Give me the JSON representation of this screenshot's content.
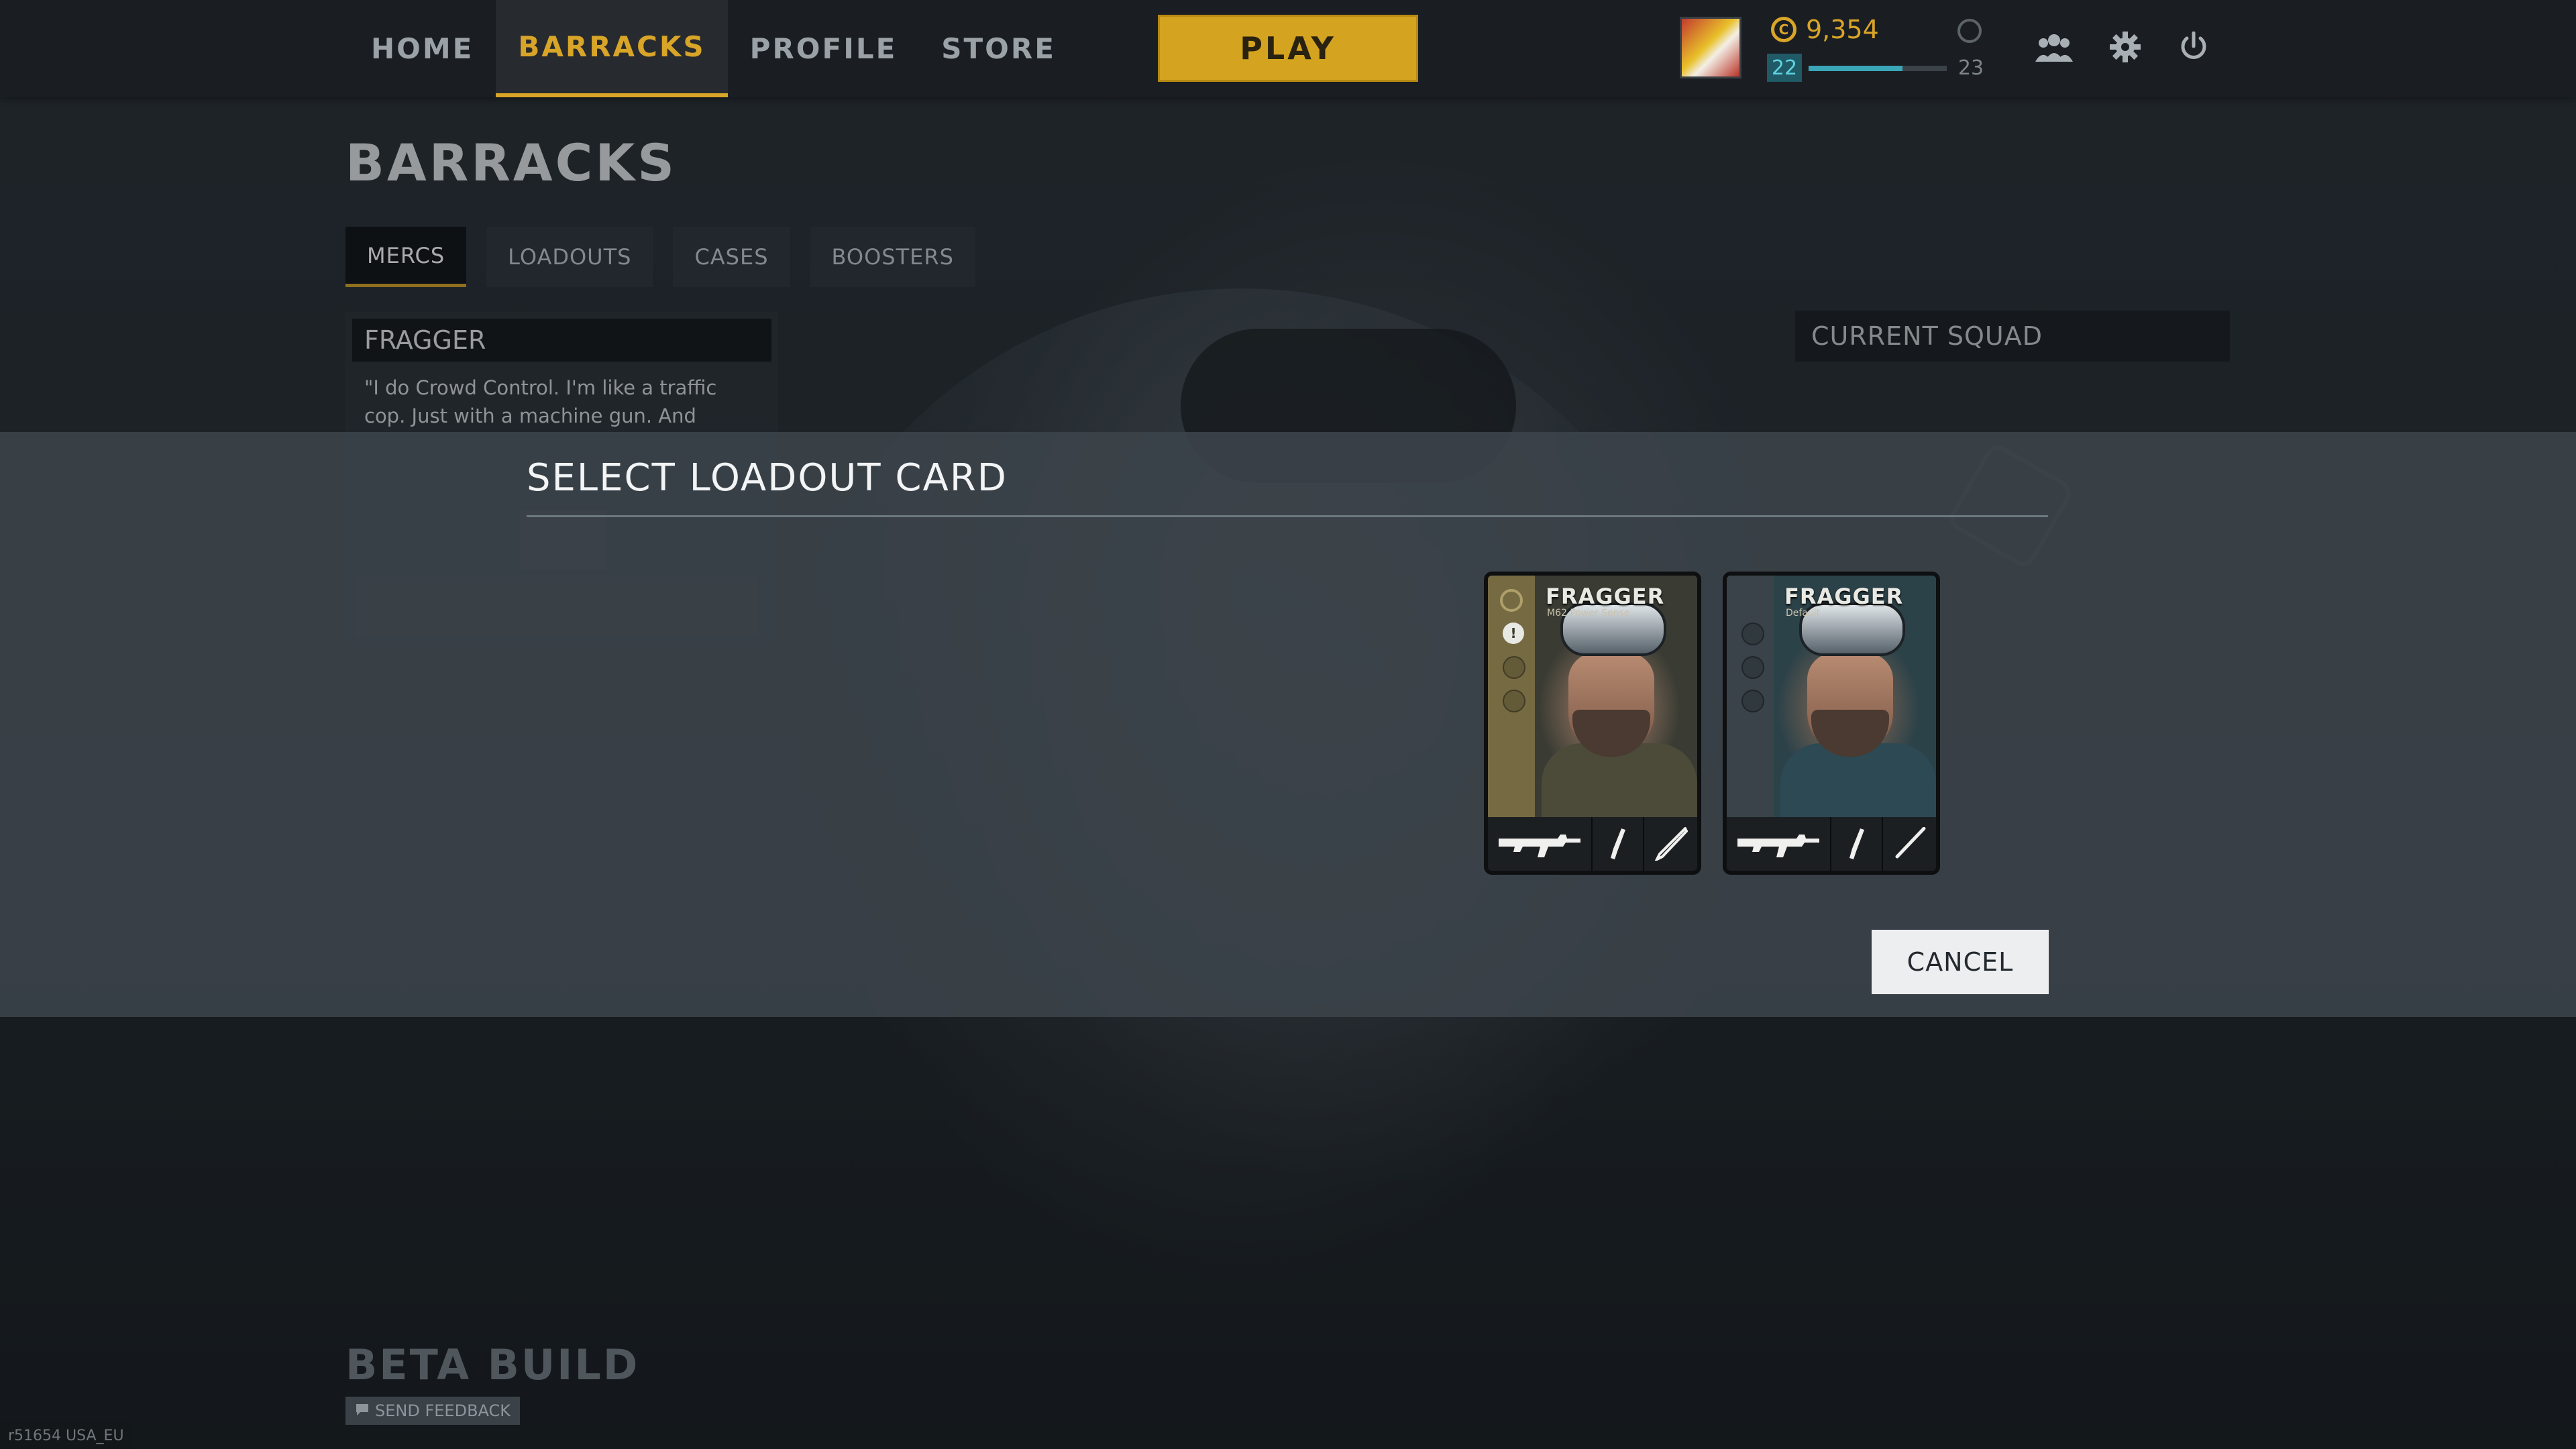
{
  "nav": {
    "items": [
      "HOME",
      "BARRACKS",
      "PROFILE",
      "STORE"
    ],
    "active_index": 1,
    "play_label": "PLAY"
  },
  "player": {
    "credits": "9,354",
    "level_current": "22",
    "level_next": "23",
    "xp_progress": 0.68
  },
  "icons": {
    "coin": "credits-icon",
    "refresh": "refresh-icon",
    "friends": "friends-icon",
    "settings": "gear-icon",
    "power": "power-icon",
    "chat": "chat-bubble-icon"
  },
  "page": {
    "title": "BARRACKS",
    "tabs": [
      "MERCS",
      "LOADOUTS",
      "CASES",
      "BOOSTERS"
    ],
    "active_tab": 0
  },
  "merc": {
    "name": "FRAGGER",
    "quote": "\"I do Crowd Control. I'm like a traffic cop. Just with a machine gun. And"
  },
  "squad": {
    "title": "CURRENT SQUAD"
  },
  "modal": {
    "title": "SELECT LOADOUT CARD",
    "cancel_label": "CANCEL",
    "cards": [
      {
        "name": "FRAGGER",
        "subtitle": "M62 Power Sense",
        "style": "gold"
      },
      {
        "name": "FRAGGER",
        "subtitle": "Default",
        "style": "blue"
      }
    ]
  },
  "footer": {
    "beta_label": "BETA BUILD",
    "feedback_label": "SEND FEEDBACK",
    "version": "r51654 USA_EU"
  },
  "colors": {
    "accent": "#d9a528",
    "xp": "#3aa6b8"
  }
}
